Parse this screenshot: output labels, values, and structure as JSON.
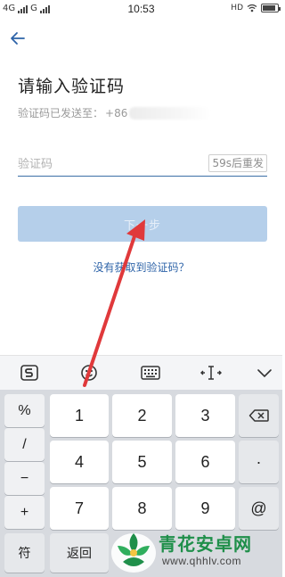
{
  "status_bar": {
    "left_indicators": [
      "4G",
      "G"
    ],
    "time": "10:53",
    "right_indicators": [
      "HD"
    ],
    "battery_level": 0.85
  },
  "header": {
    "back_icon": "arrow-left-icon",
    "title": "请输入验证码"
  },
  "verification": {
    "sent_prefix": "验证码已发送至：",
    "sent_number_visible": "+86",
    "code_placeholder": "验证码",
    "code_value": "",
    "resend_label": "59s后重发"
  },
  "actions": {
    "next_label": "下一步",
    "no_code_link": "没有获取到验证码？"
  },
  "keyboard_toolbar": {
    "items": [
      "sogou-logo-icon",
      "emoji-icon",
      "keyboard-icon",
      "cursor-move-icon",
      "collapse-icon"
    ]
  },
  "keyboard": {
    "side_keys": [
      "%",
      "/",
      "−",
      "+"
    ],
    "digits": [
      "1",
      "2",
      "3",
      "4",
      "5",
      "6",
      "7",
      "8",
      "9"
    ],
    "right_keys": [
      "backspace-icon",
      "·",
      "@"
    ],
    "bottom_keys": [
      "符",
      "返回"
    ]
  },
  "colors": {
    "accent": "#2d63a8",
    "button_disabled": "#b5cfea",
    "annotation_arrow": "#e0393b",
    "watermark_green": "#1f8f4a"
  },
  "watermark": {
    "title": "青花安卓网",
    "url": "www.qhhlv.com"
  }
}
